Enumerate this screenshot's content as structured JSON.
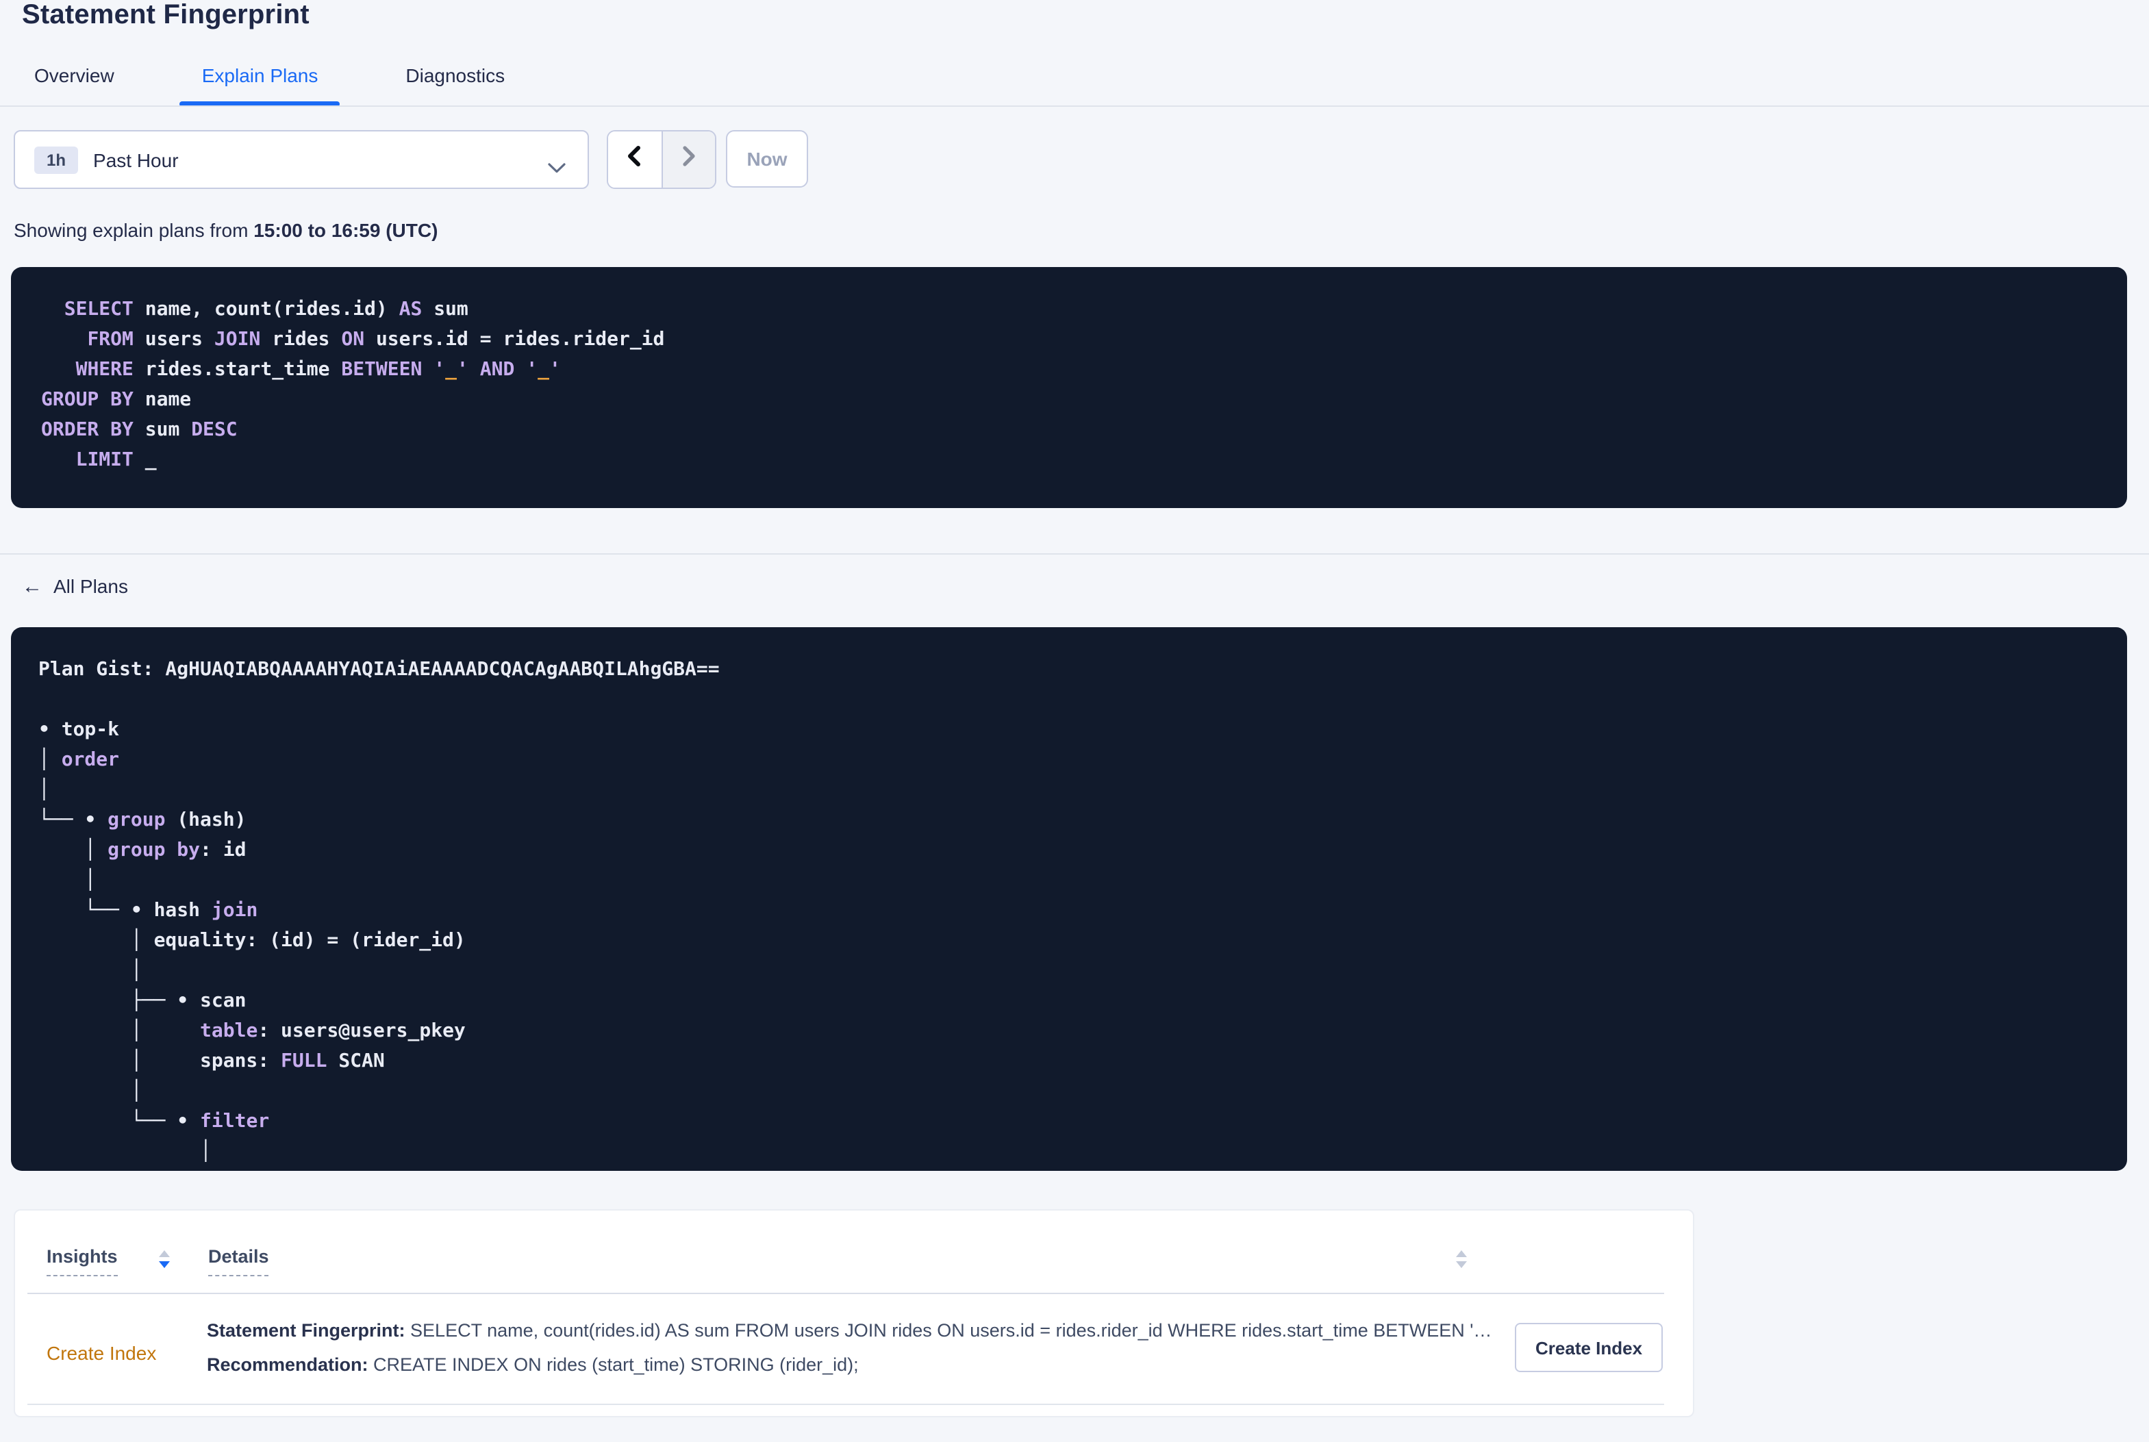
{
  "page": {
    "title": "Statement Fingerprint"
  },
  "tabs": [
    {
      "label": "Overview",
      "active": false
    },
    {
      "label": "Explain Plans",
      "active": true
    },
    {
      "label": "Diagnostics",
      "active": false
    }
  ],
  "time_controls": {
    "range_badge": "1h",
    "range_label": "Past Hour",
    "now_label": "Now",
    "icons": {
      "dropdown": "chevron-down-icon",
      "prev": "chevron-left-icon",
      "next": "chevron-right-icon"
    }
  },
  "subtitle": {
    "prefix": "Showing explain plans from ",
    "range": "15:00 to 16:59 (UTC)"
  },
  "sql_block": {
    "lines": [
      [
        {
          "t": "  ",
          "c": "pl"
        },
        {
          "t": "SELECT",
          "c": "kw"
        },
        {
          "t": " name, count(rides.id) ",
          "c": "pl"
        },
        {
          "t": "AS",
          "c": "kw"
        },
        {
          "t": " sum",
          "c": "pl"
        }
      ],
      [
        {
          "t": "    ",
          "c": "pl"
        },
        {
          "t": "FROM",
          "c": "kw"
        },
        {
          "t": " users ",
          "c": "pl"
        },
        {
          "t": "JOIN",
          "c": "kw"
        },
        {
          "t": " rides ",
          "c": "pl"
        },
        {
          "t": "ON",
          "c": "kw"
        },
        {
          "t": " users.id = rides.rider_id",
          "c": "pl"
        }
      ],
      [
        {
          "t": "   ",
          "c": "pl"
        },
        {
          "t": "WHERE",
          "c": "kw"
        },
        {
          "t": " rides.start_time ",
          "c": "pl"
        },
        {
          "t": "BETWEEN",
          "c": "kw"
        },
        {
          "t": " ",
          "c": "pl"
        },
        {
          "t": "'",
          "c": "kw"
        },
        {
          "t": "_",
          "c": "or"
        },
        {
          "t": "'",
          "c": "kw"
        },
        {
          "t": " ",
          "c": "pl"
        },
        {
          "t": "AND",
          "c": "kw"
        },
        {
          "t": " ",
          "c": "pl"
        },
        {
          "t": "'",
          "c": "kw"
        },
        {
          "t": "_",
          "c": "or"
        },
        {
          "t": "'",
          "c": "kw"
        }
      ],
      [
        {
          "t": "GROUP BY",
          "c": "kw"
        },
        {
          "t": " name",
          "c": "pl"
        }
      ],
      [
        {
          "t": "ORDER BY",
          "c": "kw"
        },
        {
          "t": " sum ",
          "c": "pl"
        },
        {
          "t": "DESC",
          "c": "kw"
        }
      ],
      [
        {
          "t": "   ",
          "c": "pl"
        },
        {
          "t": "LIMIT",
          "c": "kw"
        },
        {
          "t": " _",
          "c": "pl"
        }
      ]
    ]
  },
  "plans_nav": {
    "back_label": "All Plans",
    "icons": {
      "back": "arrow-left-icon"
    }
  },
  "gist_block": {
    "lines": [
      [
        {
          "t": "Plan Gist: AgHUAQIABQAAAAHYAQIAiAEAAAADCQACAgAABQILAhgGBA==",
          "c": "pl"
        }
      ],
      [
        {
          "t": "",
          "c": "pl"
        }
      ],
      [
        {
          "t": "• top-k",
          "c": "pl"
        }
      ],
      [
        {
          "t": "│ ",
          "c": "pl"
        },
        {
          "t": "order",
          "c": "kw"
        }
      ],
      [
        {
          "t": "│",
          "c": "pl"
        }
      ],
      [
        {
          "t": "└── • ",
          "c": "pl"
        },
        {
          "t": "group",
          "c": "kw"
        },
        {
          "t": " (hash)",
          "c": "pl"
        }
      ],
      [
        {
          "t": "    │ ",
          "c": "pl"
        },
        {
          "t": "group by",
          "c": "kw"
        },
        {
          "t": ": id",
          "c": "pl"
        }
      ],
      [
        {
          "t": "    │",
          "c": "pl"
        }
      ],
      [
        {
          "t": "    └── • hash ",
          "c": "pl"
        },
        {
          "t": "join",
          "c": "kw"
        }
      ],
      [
        {
          "t": "        │ equality: (id) = (rider_id)",
          "c": "pl"
        }
      ],
      [
        {
          "t": "        │",
          "c": "pl"
        }
      ],
      [
        {
          "t": "        ├── • scan",
          "c": "pl"
        }
      ],
      [
        {
          "t": "        │     ",
          "c": "pl"
        },
        {
          "t": "table",
          "c": "kw"
        },
        {
          "t": ": users@users_pkey",
          "c": "pl"
        }
      ],
      [
        {
          "t": "        │     spans: ",
          "c": "pl"
        },
        {
          "t": "FULL",
          "c": "kw"
        },
        {
          "t": " SCAN",
          "c": "pl"
        }
      ],
      [
        {
          "t": "        │",
          "c": "pl"
        }
      ],
      [
        {
          "t": "        └── • ",
          "c": "pl"
        },
        {
          "t": "filter",
          "c": "kw"
        }
      ],
      [
        {
          "t": "              │",
          "c": "pl"
        }
      ]
    ]
  },
  "insights": {
    "columns": [
      {
        "label": "Insights",
        "sort": "desc"
      },
      {
        "label": "Details",
        "sort": "none"
      }
    ],
    "rows": [
      {
        "type_label": "Create Index",
        "fingerprint_label": "Statement Fingerprint:",
        "fingerprint_text": " SELECT name, count(rides.id) AS sum FROM users JOIN rides ON users.id = rides.rider_id WHERE rides.start_time BETWEEN '_…",
        "recommendation_label": "Recommendation:",
        "recommendation_text": " CREATE INDEX ON rides (start_time) STORING (rider_id);",
        "action_label": "Create Index"
      }
    ]
  },
  "colors": {
    "accent_blue": "#1A6AF5",
    "code_background": "#111A2C",
    "code_keyword": "#C7ADEE",
    "code_literal_orange": "#EFA43E",
    "code_text": "#E9ECF5",
    "insight_link_orange": "#C1760D",
    "page_background": "#F4F6FA",
    "text_dark": "#242B49"
  }
}
